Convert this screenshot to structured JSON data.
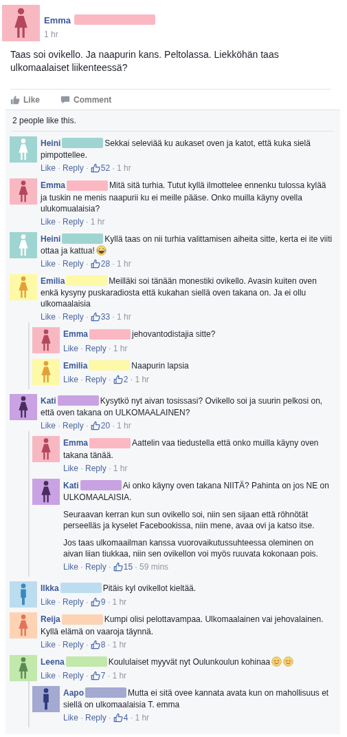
{
  "post": {
    "author": {
      "name": "Emma",
      "redaction": {
        "color": "#fbb8c3"
      },
      "avatar": {
        "kind": "female",
        "color": "#f8b8c2",
        "figure": {
          "color": "#b4475d"
        }
      }
    },
    "time": "1 hr",
    "text": "Taas soi ovikello. Ja naapurin kans. Peltolassa. Liekköhän taas ulkomaalaiset liikenteessä?"
  },
  "actions": [
    {
      "kind": "like",
      "label": "Like"
    },
    {
      "kind": "comment",
      "label": "Comment"
    }
  ],
  "likes_summary": "2 people like this.",
  "meta_separator": "·",
  "comments": [
    {
      "name": "Heini",
      "redaction": {
        "color": "#9fd5d1"
      },
      "avatar": {
        "kind": "female",
        "color": "#9fd5d1",
        "figure": {
          "color": "#ffffff"
        }
      },
      "paragraphs": [
        "Sekkai seleviää ku aukaset oven ja katot, että kuka sielä pimpottellee."
      ],
      "like": "Like",
      "reply": "Reply",
      "likes": "52",
      "time": "1 hr"
    },
    {
      "name": "Emma",
      "redaction": {
        "color": "#fbb8c3"
      },
      "avatar": {
        "kind": "female",
        "color": "#f8b8c2",
        "figure": {
          "color": "#b4475d"
        }
      },
      "paragraphs": [
        "Mitä sitä turhia. Tutut kyllä ilmottelee ennenku tulossa kylää ja tuskin ne menis naapurii ku ei meille pääse. Onko muilla käyny ovella ulukomualaisia?"
      ],
      "like": "Like",
      "reply": "Reply",
      "time": "1 hr"
    },
    {
      "name": "Heini",
      "redaction": {
        "color": "#9fd5d1"
      },
      "avatar": {
        "kind": "female",
        "color": "#9fd5d1",
        "figure": {
          "color": "#ffffff"
        }
      },
      "paragraphs": [
        "Kyllä taas on nii turhia valittamisen aiheita sitte, kerta ei ite viiti ottaa ja kattua!"
      ],
      "emojis": [
        {
          "kind": "tears-of-joy"
        }
      ],
      "like": "Like",
      "reply": "Reply",
      "likes": "28",
      "time": "1 hr"
    },
    {
      "name": "Emilia",
      "redaction": {
        "color": "#fdf9a6"
      },
      "avatar": {
        "kind": "female",
        "color": "#fdf9a6",
        "figure": {
          "color": "#e3a03a"
        }
      },
      "paragraphs": [
        "Meilläki soi tänään monestiki ovikello. Avasin kuiten oven enkä kysyny puskaradiosta että kukahan siellä oven takana on. Ja ei ollu ulkomaalaisia"
      ],
      "like": "Like",
      "reply": "Reply",
      "likes": "33",
      "time": "1 hr",
      "replies": [
        {
          "name": "Emma",
          "redaction": {
            "color": "#fbb8c3"
          },
          "avatar": {
            "kind": "female",
            "color": "#f8b8c2",
            "figure": {
              "color": "#b4475d"
            }
          },
          "paragraphs": [
            "jehovantodistajia sitte?"
          ],
          "like": "Like",
          "reply": "Reply",
          "time": "1 hr"
        },
        {
          "name": "Emilia",
          "redaction": {
            "color": "#fdf9a6"
          },
          "avatar": {
            "kind": "female",
            "color": "#fdf9a6",
            "figure": {
              "color": "#e3a03a"
            }
          },
          "paragraphs": [
            "Naapurin lapsia"
          ],
          "like": "Like",
          "reply": "Reply",
          "likes": "2",
          "time": "1 hr"
        }
      ]
    },
    {
      "name": "Kati",
      "redaction": {
        "color": "#c9a2e3"
      },
      "avatar": {
        "kind": "female",
        "color": "#c9a2e3",
        "figure": {
          "color": "#4b2c5e"
        }
      },
      "paragraphs": [
        "Kysytkö nyt aivan tosissasi? Ovikello soi ja suurin pelkosi on, että oven takana on ULKOMAALAINEN?"
      ],
      "like": "Like",
      "reply": "Reply",
      "likes": "20",
      "time": "1 hr",
      "replies": [
        {
          "name": "Emma",
          "redaction": {
            "color": "#fbb8c3"
          },
          "avatar": {
            "kind": "female",
            "color": "#f8b8c2",
            "figure": {
              "color": "#b4475d"
            }
          },
          "paragraphs": [
            "Aattelin vaa tiedustella että onko muilla käyny oven takana tänää."
          ],
          "like": "Like",
          "reply": "Reply",
          "time": "1 hr"
        },
        {
          "name": "Kati",
          "redaction": {
            "color": "#c9a2e3"
          },
          "avatar": {
            "kind": "female",
            "color": "#c9a2e3",
            "figure": {
              "color": "#4b2c5e"
            }
          },
          "paragraphs": [
            "Ai onko käyny oven takana NIITÄ? Pahinta on jos NE on ULKOMAALAISIA.",
            "Seuraavan kerran kun sun ovikello soi, niin sen sijaan että röhnötät perseelläs ja kyselet Facebookissa, niin mene, avaa ovi ja katso itse.",
            "Jos taas ulkomaailman kanssa vuorovaikutussuhteessa oleminen on aivan liian tiukkaa, niin sen ovikellon voi myös ruuvata kokonaan pois."
          ],
          "like": "Like",
          "reply": "Reply",
          "likes": "15",
          "time": "59 mins"
        }
      ]
    },
    {
      "name": "Ilkka",
      "redaction": {
        "color": "#bcdcf0"
      },
      "avatar": {
        "kind": "male",
        "color": "#bcdcf0",
        "figure": {
          "color": "#3b88bf"
        }
      },
      "paragraphs": [
        "Pitäis kyl ovikellot kieltää."
      ],
      "like": "Like",
      "reply": "Reply",
      "likes": "9",
      "time": "1 hr"
    },
    {
      "name": "Reija",
      "redaction": {
        "color": "#fdd3b4"
      },
      "avatar": {
        "kind": "female",
        "color": "#fdd3b4",
        "figure": {
          "color": "#e2735a"
        }
      },
      "paragraphs": [
        "Kumpi olisi pelottavampaa. Ulkomaalainen vai jehovalainen. Kyllä elämä on vaaroja täynnä."
      ],
      "like": "Like",
      "reply": "Reply",
      "likes": "8",
      "time": "1 hr"
    },
    {
      "name": "Leena",
      "redaction": {
        "color": "#c3e8ab"
      },
      "avatar": {
        "kind": "female",
        "color": "#c3e8ab",
        "figure": {
          "color": "#5b8a52"
        }
      },
      "paragraphs": [
        "Koululaiset myyvät nyt Oulunkoulun kohinaa"
      ],
      "emojis": [
        {
          "kind": "smiling"
        },
        {
          "kind": "smiling"
        }
      ],
      "like": "Like",
      "reply": "Reply",
      "likes": "7",
      "time": "1 hr",
      "replies": [
        {
          "name": "Aapo",
          "redaction": {
            "color": "#a3a9d1"
          },
          "avatar": {
            "kind": "male",
            "color": "#a3a9d1",
            "figure": {
              "color": "#2f3a7e"
            }
          },
          "paragraphs": [
            "Mutta ei sitä ovee kannata avata kun on mahollisuus et siellä on ulkomaalaisia T. emma"
          ],
          "like": "Like",
          "reply": "Reply",
          "likes": "4",
          "time": "1 hr"
        }
      ]
    }
  ]
}
